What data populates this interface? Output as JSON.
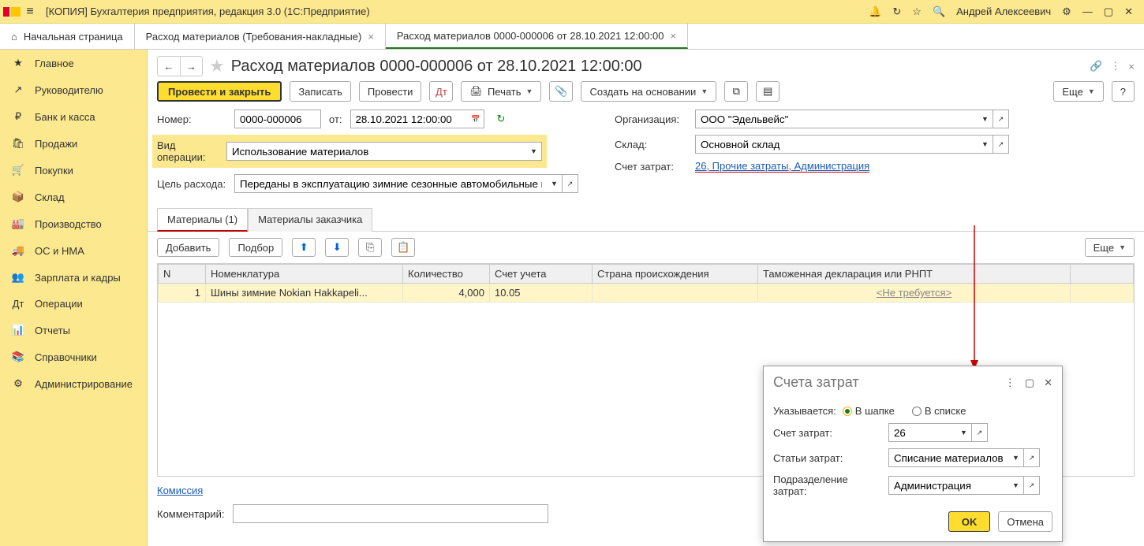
{
  "titlebar": {
    "title": "[КОПИЯ] Бухгалтерия предприятия, редакция 3.0  (1С:Предприятие)",
    "username": "Андрей Алексеевич"
  },
  "tabs": {
    "home": "Начальная страница",
    "t1": "Расход материалов (Требования-накладные)",
    "t2": "Расход материалов 0000-000006 от 28.10.2021 12:00:00"
  },
  "sidebar": {
    "items": [
      {
        "label": "Главное",
        "icon": "★"
      },
      {
        "label": "Руководителю",
        "icon": "↗"
      },
      {
        "label": "Банк и касса",
        "icon": "₽"
      },
      {
        "label": "Продажи",
        "icon": "🛍"
      },
      {
        "label": "Покупки",
        "icon": "🛒"
      },
      {
        "label": "Склад",
        "icon": "📦"
      },
      {
        "label": "Производство",
        "icon": "🏭"
      },
      {
        "label": "ОС и НМА",
        "icon": "🚚"
      },
      {
        "label": "Зарплата и кадры",
        "icon": "👥"
      },
      {
        "label": "Операции",
        "icon": "Дт"
      },
      {
        "label": "Отчеты",
        "icon": "📊"
      },
      {
        "label": "Справочники",
        "icon": "📚"
      },
      {
        "label": "Администрирование",
        "icon": "⚙"
      }
    ]
  },
  "doc": {
    "title": "Расход материалов 0000-000006 от 28.10.2021 12:00:00",
    "actions": {
      "post_close": "Провести и закрыть",
      "save": "Записать",
      "post": "Провести",
      "print": "Печать",
      "create_based": "Создать на основании",
      "more": "Еще",
      "help": "?"
    },
    "labels": {
      "number": "Номер:",
      "from": "от:",
      "op_type": "Вид операции:",
      "purpose": "Цель расхода:",
      "org": "Организация:",
      "warehouse": "Склад:",
      "cost_acc": "Счет затрат:"
    },
    "values": {
      "number": "0000-000006",
      "date": "28.10.2021 12:00:00",
      "op_type": "Использование материалов",
      "purpose": "Переданы в эксплуатацию зимние сезонные автомобильные шины",
      "org": "ООО \"Эдельвейс\"",
      "warehouse": "Основной склад",
      "cost_acc": "26, Прочие затраты, Администрация"
    },
    "tabs2": {
      "t1": "Материалы (1)",
      "t2": "Материалы заказчика"
    },
    "tablebar": {
      "add": "Добавить",
      "pick": "Подбор",
      "more": "Еще"
    },
    "grid": {
      "cols": {
        "n": "N",
        "nomen": "Номенклатура",
        "qty": "Количество",
        "acc": "Счет учета",
        "country": "Страна происхождения",
        "gtd": "Таможенная декларация или РНПТ"
      },
      "row0": {
        "n": "1",
        "nomen": "Шины зимние Nokian Hakkapeli...",
        "qty": "4,000",
        "acc": "10.05",
        "country": "",
        "gtd": "<Не требуется>"
      }
    },
    "footer": {
      "commission": "Комиссия",
      "comment_label": "Комментарий:",
      "comment_value": ""
    }
  },
  "dialog": {
    "title": "Счета затрат",
    "spec_label": "Указывается:",
    "opt_header": "В шапке",
    "opt_list": "В списке",
    "row_acc": "Счет затрат:",
    "row_items": "Статьи затрат:",
    "row_dept": "Подразделение затрат:",
    "val_acc": "26",
    "val_items": "Списание материалов",
    "val_dept": "Администрация",
    "ok": "OK",
    "cancel": "Отмена"
  }
}
